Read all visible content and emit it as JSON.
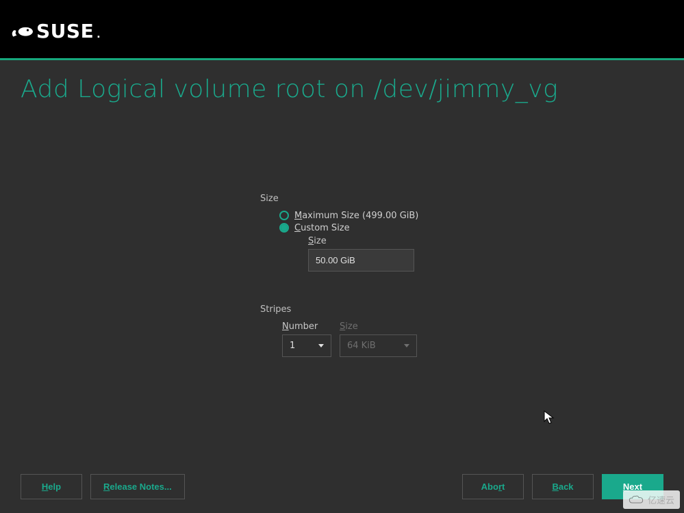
{
  "brand": {
    "name": "SUSE"
  },
  "page": {
    "title": "Add Logical volume root on /dev/jimmy_vg"
  },
  "size_section": {
    "label": "Size",
    "radios": {
      "max": {
        "mnemonic": "M",
        "rest": "aximum Size (499.00 GiB)",
        "selected": false
      },
      "custom": {
        "mnemonic": "C",
        "rest": "ustom Size",
        "selected": true
      }
    },
    "size_field": {
      "label_mnemonic": "S",
      "label_rest": "ize",
      "value": "50.00 GiB"
    }
  },
  "stripes_section": {
    "label": "Stripes",
    "number": {
      "label_mnemonic": "N",
      "label_rest": "umber",
      "value": "1"
    },
    "stripe_size": {
      "label_mnemonic": "S",
      "label_rest": "ize",
      "value": "64 KiB",
      "disabled": true
    }
  },
  "footer": {
    "help": {
      "mnemonic": "H",
      "rest": "elp"
    },
    "release_notes": {
      "mnemonic": "R",
      "rest": "elease Notes..."
    },
    "abort": {
      "pre": "Abo",
      "mnemonic": "r",
      "post": "t"
    },
    "back": {
      "mnemonic": "B",
      "rest": "ack"
    },
    "next": {
      "mnemonic": "N",
      "rest": "ext"
    }
  },
  "watermark": "亿速云"
}
